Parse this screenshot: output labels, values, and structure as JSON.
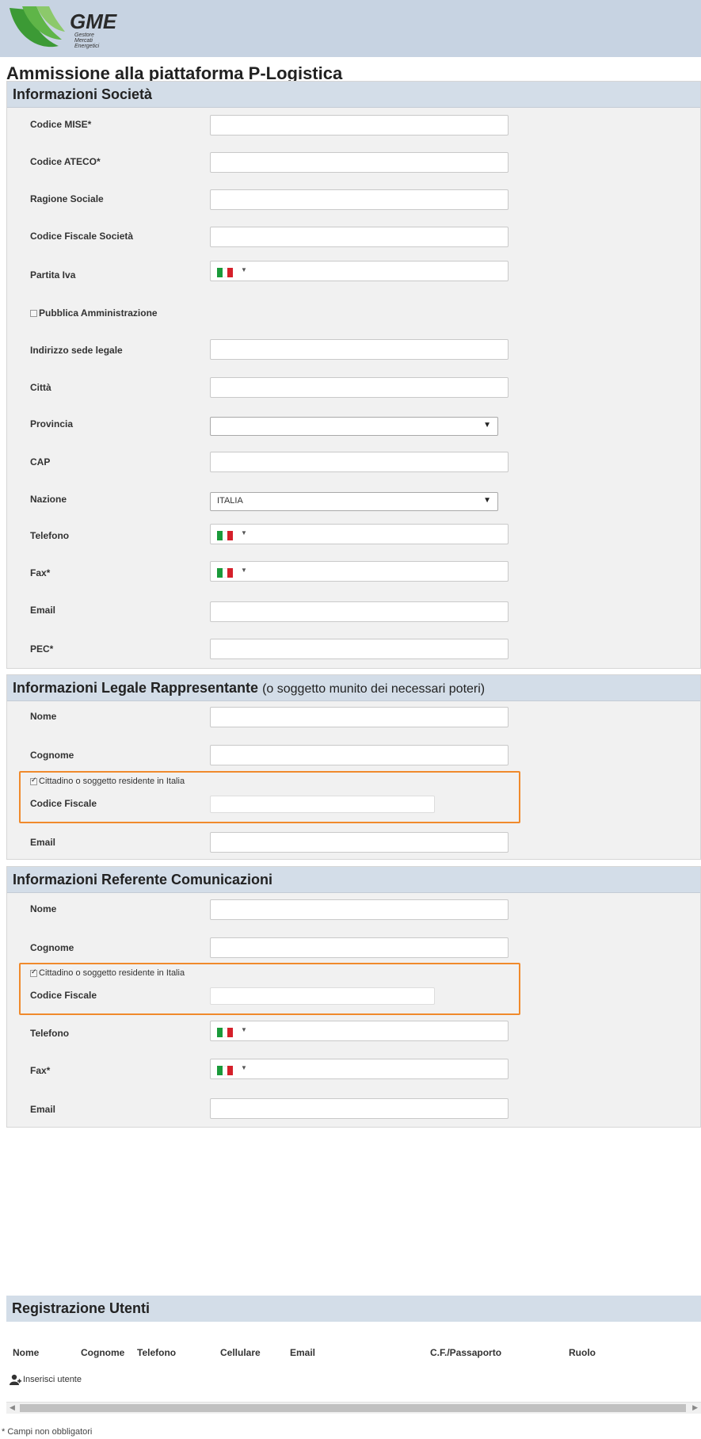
{
  "brand": {
    "name": "GME",
    "tagline_lines": [
      "Gestore",
      "Mercati",
      "Energetici"
    ],
    "colors": {
      "green": "#3c9a35",
      "header": "#c7d3e2",
      "highlight": "#f08a2c"
    }
  },
  "page_title": "Ammissione alla piattaforma P-Logistica",
  "company": {
    "heading": "Informazioni Società",
    "fields": {
      "codice_mise": "Codice MISE*",
      "codice_ateco": "Codice ATECO*",
      "ragione_sociale": "Ragione Sociale",
      "codice_fiscale": "Codice Fiscale Società",
      "partita_iva": "Partita Iva",
      "pubblica_amm": "Pubblica Amministrazione",
      "indirizzo": "Indirizzo sede legale",
      "citta": "Città",
      "provincia": "Provincia",
      "cap": "CAP",
      "nazione": "Nazione",
      "telefono": "Telefono",
      "fax": "Fax*",
      "email": "Email",
      "pec": "PEC*"
    },
    "nazione_value": "ITALIA",
    "provincia_value": "",
    "pubblica_amm_checked": false
  },
  "legal_rep": {
    "heading": "Informazioni Legale Rappresentante",
    "heading_note": "(o soggetto munito dei necessari poteri)",
    "nome": "Nome",
    "cognome": "Cognome",
    "resident": "Cittadino o soggetto residente in Italia",
    "resident_checked": true,
    "codice_fiscale": "Codice Fiscale",
    "email": "Email"
  },
  "contact": {
    "heading": "Informazioni Referente Comunicazioni",
    "nome": "Nome",
    "cognome": "Cognome",
    "resident": "Cittadino o soggetto residente in Italia",
    "resident_checked": true,
    "codice_fiscale": "Codice Fiscale",
    "telefono": "Telefono",
    "fax": "Fax*",
    "email": "Email"
  },
  "users": {
    "heading": "Registrazione Utenti",
    "columns": [
      "Nome",
      "Cognome",
      "Telefono",
      "Cellulare",
      "Email",
      "C.F./Passaporto",
      "Ruolo"
    ],
    "add_label": "Inserisci utente"
  },
  "footnote": "* Campi non obbligatori",
  "phone_country_icon": "italy-flag-icon"
}
